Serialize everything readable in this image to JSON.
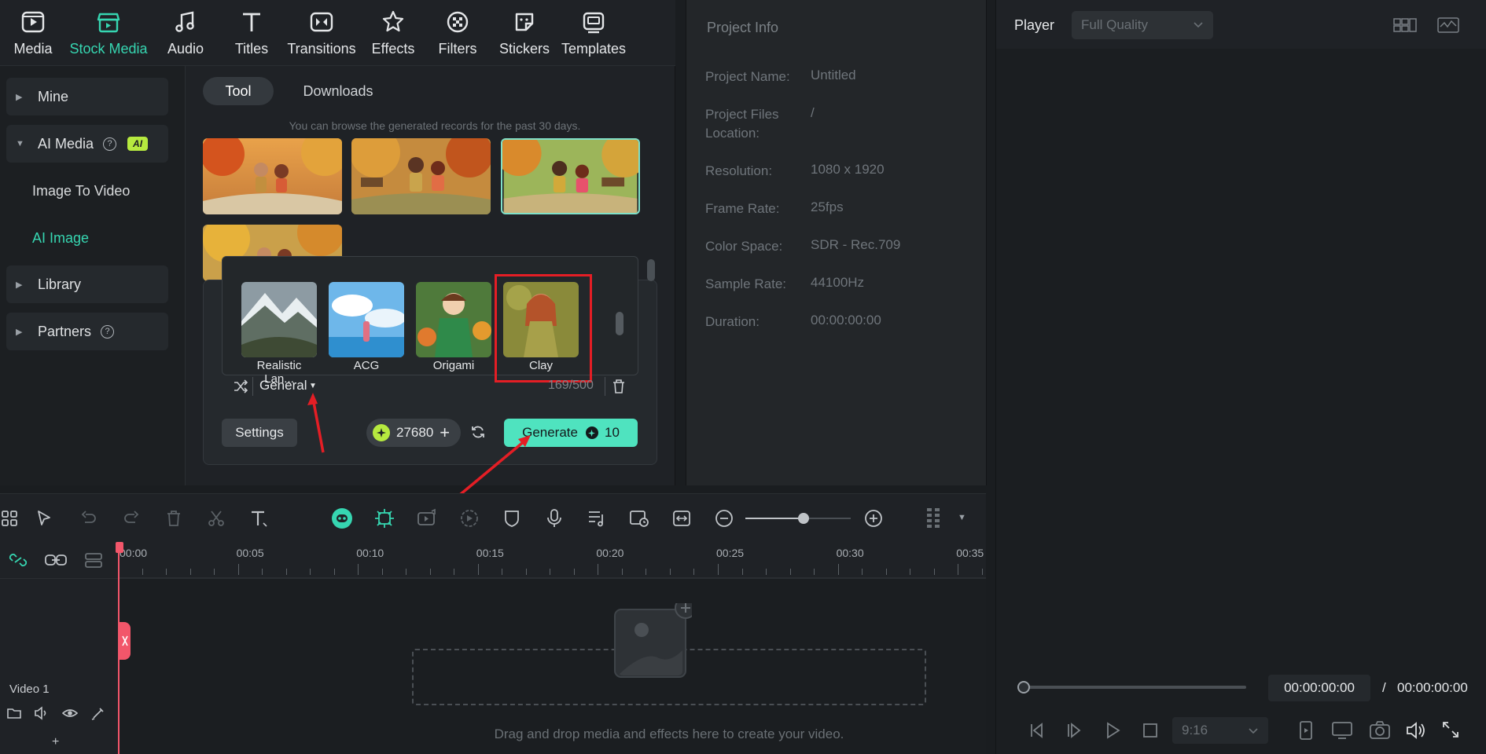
{
  "top_toolbar": {
    "items": [
      {
        "label": "Media",
        "icon": "media-icon"
      },
      {
        "label": "Stock Media",
        "icon": "stock-media-icon",
        "active": true
      },
      {
        "label": "Audio",
        "icon": "audio-icon"
      },
      {
        "label": "Titles",
        "icon": "titles-icon"
      },
      {
        "label": "Transitions",
        "icon": "transitions-icon"
      },
      {
        "label": "Effects",
        "icon": "effects-icon"
      },
      {
        "label": "Filters",
        "icon": "filters-icon"
      },
      {
        "label": "Stickers",
        "icon": "stickers-icon"
      },
      {
        "label": "Templates",
        "icon": "templates-icon"
      }
    ],
    "accent_color": "#36d6b1"
  },
  "sidebar": {
    "mine": "Mine",
    "ai_media": "AI Media",
    "ai_badge": "AI",
    "image_to_video": "Image To Video",
    "ai_image": "AI Image",
    "library": "Library",
    "partners": "Partners"
  },
  "content": {
    "tabs": [
      {
        "label": "Tool",
        "active": true
      },
      {
        "label": "Downloads"
      }
    ],
    "notice": "You can browse the generated records for the past 30 days.",
    "styles": [
      {
        "label": "Realistic Lan...",
        "icon": "landscape-thumbnail"
      },
      {
        "label": "ACG",
        "icon": "anime-thumbnail"
      },
      {
        "label": "Origami",
        "icon": "origami-thumbnail"
      },
      {
        "label": "Clay",
        "icon": "clay-thumbnail",
        "selected": true
      }
    ],
    "category": "General",
    "char_count": "169/500",
    "settings_label": "Settings",
    "credits": "27680",
    "generate_label": "Generate",
    "generate_cost": "10"
  },
  "project_info": {
    "title": "Project Info",
    "rows": [
      {
        "key": "Project Name:",
        "value": "Untitled"
      },
      {
        "key": "Project Files Location:",
        "value": "/"
      },
      {
        "key": "Resolution:",
        "value": "1080 x 1920"
      },
      {
        "key": "Frame Rate:",
        "value": "25fps"
      },
      {
        "key": "Color Space:",
        "value": "SDR - Rec.709"
      },
      {
        "key": "Sample Rate:",
        "value": "44100Hz"
      },
      {
        "key": "Duration:",
        "value": "00:00:00:00"
      }
    ]
  },
  "player": {
    "label": "Player",
    "quality": "Full Quality",
    "current_time": "00:00:00:00",
    "separator": "/",
    "total_time": "00:00:00:00",
    "aspect": "9:16"
  },
  "timeline": {
    "ticks": [
      "00:00",
      "00:05",
      "00:10",
      "00:15",
      "00:20",
      "00:25",
      "00:30",
      "00:35"
    ],
    "track_name": "Video 1",
    "drop_hint": "Drag and drop media and effects here to create your video.",
    "zoom_level": 0.55
  }
}
